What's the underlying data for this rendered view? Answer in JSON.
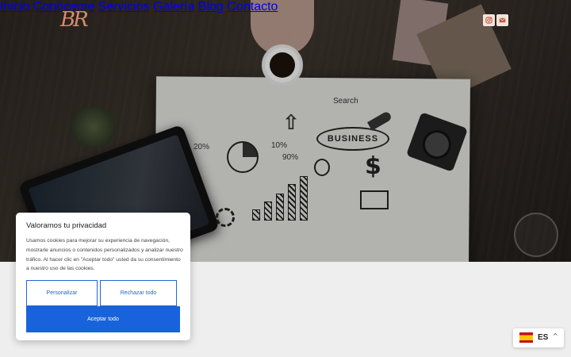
{
  "header": {
    "logo_text": "BR",
    "nav": [
      {
        "label": "Inicio"
      },
      {
        "label": "Conóceme"
      },
      {
        "label": "Servicios"
      },
      {
        "label": "Galería"
      },
      {
        "label": "Blog"
      },
      {
        "label": "Contacto"
      }
    ],
    "social_icons": [
      "instagram-icon",
      "mail-icon"
    ]
  },
  "hero": {
    "doodle_business": "BUSINESS",
    "doodle_search": "Search",
    "doodle_pct1": "20%",
    "doodle_pct2": "10%",
    "doodle_pct3": "90%"
  },
  "cookie_banner": {
    "title": "Valoramos tu privacidad",
    "text": "Usamos cookies para mejorar su experiencia de navegación, mostrarle anuncios o contenidos personalizados y analizar nuestro tráfico. Al hacer clic en \"Aceptar todo\" usted da su consentimiento a nuestro uso de las cookies.",
    "customize_label": "Personalizar",
    "reject_label": "Rechazar todo",
    "accept_label": "Aceptar todo"
  },
  "language_switcher": {
    "code": "ES",
    "flag": "spain-flag-icon",
    "chevron": "chevron-up-icon"
  },
  "colors": {
    "accent_blue": "#1863dc",
    "logo": "#d98a6c",
    "social_bg": "#f2e3dc",
    "page_bg": "#eeeeee"
  }
}
